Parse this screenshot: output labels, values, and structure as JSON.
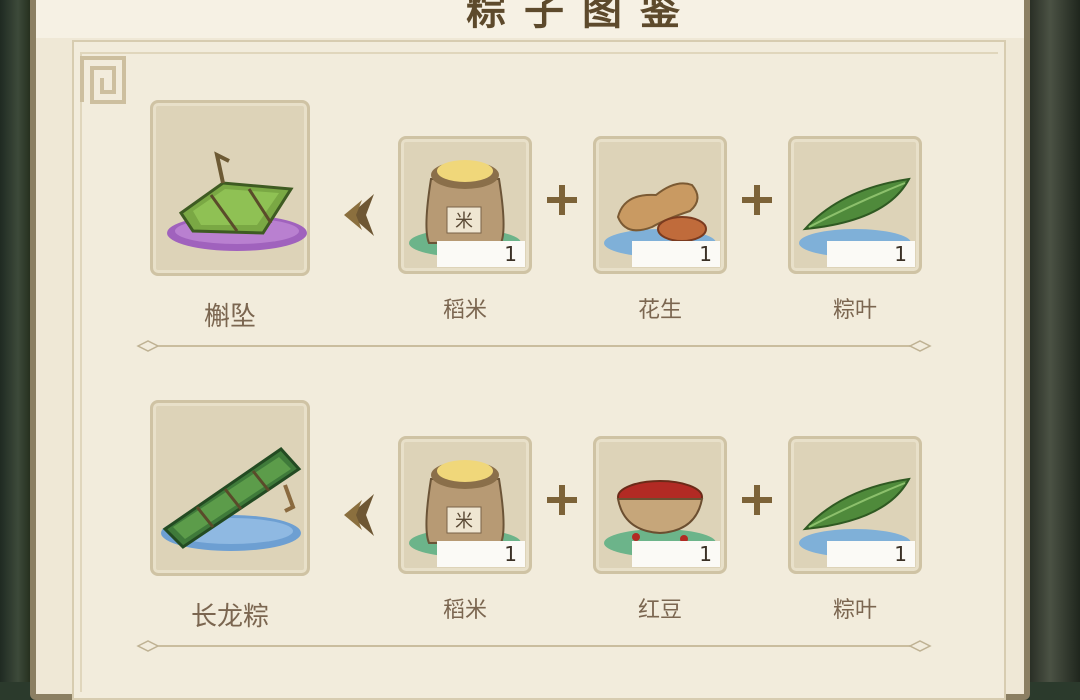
{
  "title_fragment": "粽子图鉴",
  "recipes": [
    {
      "result": {
        "name": "槲坠",
        "icon": "hudui-zongzi-icon"
      },
      "ingredients": [
        {
          "name": "稻米",
          "qty": "1",
          "icon": "rice-bag-icon"
        },
        {
          "name": "花生",
          "qty": "1",
          "icon": "peanut-icon"
        },
        {
          "name": "粽叶",
          "qty": "1",
          "icon": "zong-leaf-icon"
        }
      ]
    },
    {
      "result": {
        "name": "长龙粽",
        "icon": "long-dragon-zongzi-icon"
      },
      "ingredients": [
        {
          "name": "稻米",
          "qty": "1",
          "icon": "rice-bag-icon"
        },
        {
          "name": "红豆",
          "qty": "1",
          "icon": "red-bean-bowl-icon"
        },
        {
          "name": "粽叶",
          "qty": "1",
          "icon": "zong-leaf-icon"
        }
      ]
    }
  ],
  "colors": {
    "panel": "#efe8d6",
    "card": "#ddd3b8",
    "text": "#7b6650",
    "accent": "#8b6f3e"
  }
}
